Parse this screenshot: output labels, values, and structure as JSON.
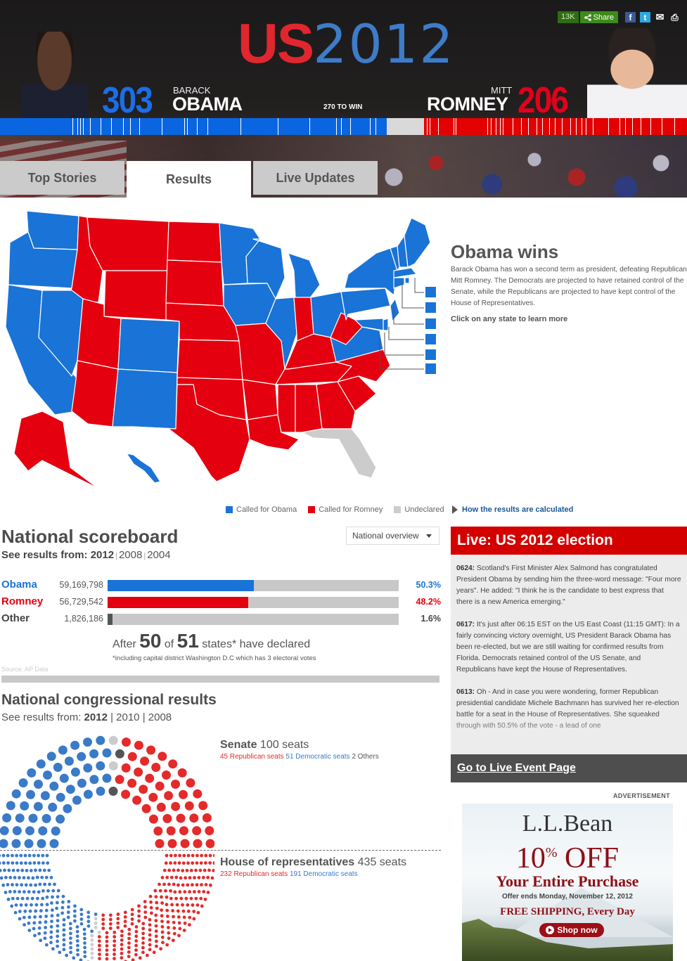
{
  "header": {
    "logo_us": "US",
    "logo_year": "2012",
    "share_count": "13K",
    "share_label": "Share",
    "icons": [
      "facebook-icon",
      "twitter-icon",
      "email-icon",
      "print-icon"
    ],
    "obama": {
      "ev": "303",
      "first": "BARACK",
      "last": "OBAMA",
      "color": "#1a6ee8"
    },
    "romney": {
      "ev": "206",
      "first": "MITT",
      "last": "ROMNEY",
      "color": "#e3001b"
    },
    "to_win": "270 TO WIN",
    "electoral_bar": {
      "total": 538,
      "democrat": 303,
      "undeclared": 29,
      "republican": 206
    }
  },
  "tabs": [
    {
      "label": "Top Stories",
      "active": false
    },
    {
      "label": "Results",
      "active": true
    },
    {
      "label": "Live Updates",
      "active": false
    }
  ],
  "map": {
    "colors": {
      "D": "#1a73d6",
      "R": "#e4000f",
      "U": "#cccccc"
    },
    "legend": [
      {
        "label": "Called for Obama",
        "color": "#1a73d6"
      },
      {
        "label": "Called for Romney",
        "color": "#e4000f"
      },
      {
        "label": "Undeclared",
        "color": "#cccccc"
      }
    ],
    "how_link": "How the results are calculated"
  },
  "summary": {
    "title": "Obama wins",
    "body": "Barack Obama has won a second term as president, defeating Republican Mitt Romney. The Democrats are projected to have retained control of the Senate, while the Republicans are projected to have kept control of the House of Representatives.",
    "cta": "Click on any state to learn more"
  },
  "scoreboard": {
    "title": "National scoreboard",
    "see_results_label": "See results from:",
    "years": [
      "2012",
      "2008",
      "2004"
    ],
    "dropdown": "National overview",
    "rows": [
      {
        "name": "Obama",
        "votes": "59,169,798",
        "pct": "50.3%",
        "share": 50.3,
        "color": "#1a73d6"
      },
      {
        "name": "Romney",
        "votes": "56,729,542",
        "pct": "48.2%",
        "share": 48.2,
        "color": "#e4000f"
      },
      {
        "name": "Other",
        "votes": "1,826,186",
        "pct": "1.6%",
        "share": 1.6,
        "color": "#555555"
      }
    ],
    "declared_pre": "After",
    "declared_count": "50",
    "declared_of": "of",
    "declared_total": "51",
    "declared_post": "states* have declared",
    "footnote": "*including capital district Washington D.C which has 3 electoral votes",
    "source": "Source: AP Data"
  },
  "congress": {
    "title": "National congressional results",
    "see_results_label": "See results from:",
    "years": [
      "2012",
      "2010",
      "2008"
    ],
    "senate": {
      "name": "Senate",
      "seats_label": "100 seats",
      "rep_label": "45 Republican seats",
      "dem_label": "51 Democratic seats",
      "oth_label": "2 Others",
      "rep": 45,
      "dem": 51,
      "oth": 2,
      "undeclared": 2
    },
    "house": {
      "name": "House of representatives",
      "seats_label": "435 seats",
      "rep_label": "232 Republican seats",
      "dem_label": "191 Democratic seats",
      "rep": 232,
      "dem": 191,
      "undeclared": 12
    }
  },
  "live": {
    "title": "Live: US 2012 election",
    "entries": [
      {
        "time": "0624:",
        "text": "Scotland's First Minister Alex Salmond has congratulated President Obama by sending him the three-word message: \"Four more years\". He added: \"I think he is the candidate to best express that there is a new America emerging.\""
      },
      {
        "time": "0617:",
        "text": "It's just after 06:15 EST on the US East Coast (11:15 GMT): In a fairly convincing victory overnight, US President Barack Obama has been re-elected, but we are still waiting for confirmed results from Florida. Democrats retained control of the US Senate, and Republicans have kept the House of Representatives."
      },
      {
        "time": "0613:",
        "text": "Oh - And in case you were wondering, former Republican presidential candidate Michele Bachmann has survived her re-election battle for a seat in the House of Representatives. She squeaked through with 50.5% of the vote - a lead of one"
      }
    ],
    "footer_link": "Go to Live Event Page"
  },
  "ad": {
    "label": "ADVERTISEMENT",
    "brand": "L.L.Bean",
    "discount": "10",
    "discount_sup": "%",
    "discount_word": "OFF",
    "headline": "Your Entire Purchase",
    "ends": "Offer ends Monday, November 12, 2012",
    "shipping": "FREE SHIPPING, Every Day",
    "button": "Shop now"
  }
}
